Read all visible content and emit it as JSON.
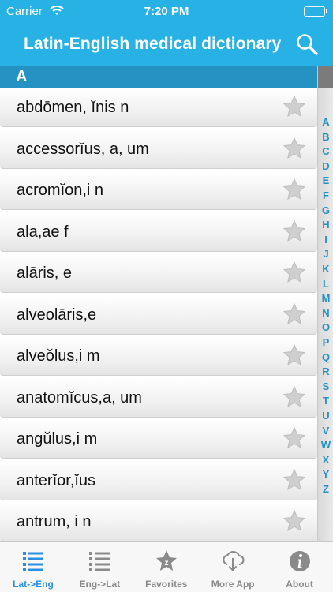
{
  "status_bar": {
    "carrier": "Carrier",
    "time": "7:20 PM"
  },
  "nav": {
    "title": "Latin-English medical dictionary"
  },
  "section": {
    "letter": "A"
  },
  "entries": [
    {
      "term": "abdōmen, ĭnis n"
    },
    {
      "term": "accessorĭus, a, um"
    },
    {
      "term": "acromĭon,i n"
    },
    {
      "term": "ala,ae f"
    },
    {
      "term": "alāris, e"
    },
    {
      "term": "alveolāris,e"
    },
    {
      "term": "alveŏlus,i m"
    },
    {
      "term": "anatomĭcus,a, um"
    },
    {
      "term": "angŭlus,i m"
    },
    {
      "term": "anterĭor,ĭus"
    },
    {
      "term": "antrum, i n"
    }
  ],
  "index_letters": [
    "A",
    "B",
    "C",
    "D",
    "E",
    "F",
    "G",
    "H",
    "I",
    "J",
    "K",
    "L",
    "M",
    "N",
    "O",
    "P",
    "Q",
    "R",
    "S",
    "T",
    "U",
    "V",
    "W",
    "X",
    "Y",
    "Z"
  ],
  "tabs": [
    {
      "label": "Lat->Eng",
      "active": true,
      "icon": "list-icon"
    },
    {
      "label": "Eng->Lat",
      "active": false,
      "icon": "list-icon"
    },
    {
      "label": "Favorites",
      "active": false,
      "icon": "star-icon"
    },
    {
      "label": "More App",
      "active": false,
      "icon": "cloud-download-icon"
    },
    {
      "label": "About",
      "active": false,
      "icon": "info-icon"
    }
  ],
  "colors": {
    "accent": "#27b1e5",
    "section": "#2492c2",
    "tab_active": "#2a8fe2",
    "tab_inactive": "#8a8a8a"
  }
}
